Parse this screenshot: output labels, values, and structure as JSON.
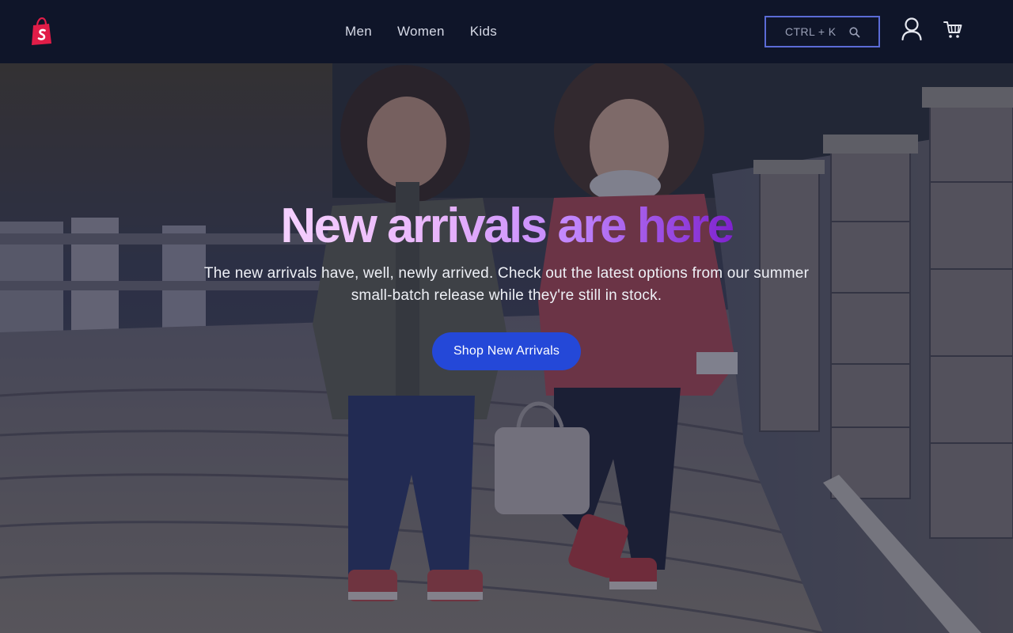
{
  "header": {
    "logo": "shopify-bag-logo",
    "nav": [
      {
        "label": "Men"
      },
      {
        "label": "Women"
      },
      {
        "label": "Kids"
      }
    ],
    "search": {
      "hint": "CTRL + K",
      "icon": "search-icon"
    },
    "account_icon": "user-icon",
    "cart_icon": "cart-icon"
  },
  "hero": {
    "title": "New arrivals are here",
    "subtitle": "The new arrivals have, well, newly arrived. Check out the latest options from our summer small-batch release while they're still in stock.",
    "cta_label": "Shop New Arrivals",
    "background": "photo-two-children-on-cobblestone-path"
  },
  "colors": {
    "header_bg": "#0f1529",
    "search_border": "#5b6bd6",
    "cta_bg": "#2448d8",
    "title_gradient_start": "#f5d0fe",
    "title_gradient_end": "#7e22ce",
    "logo_red": "#e11d48"
  }
}
